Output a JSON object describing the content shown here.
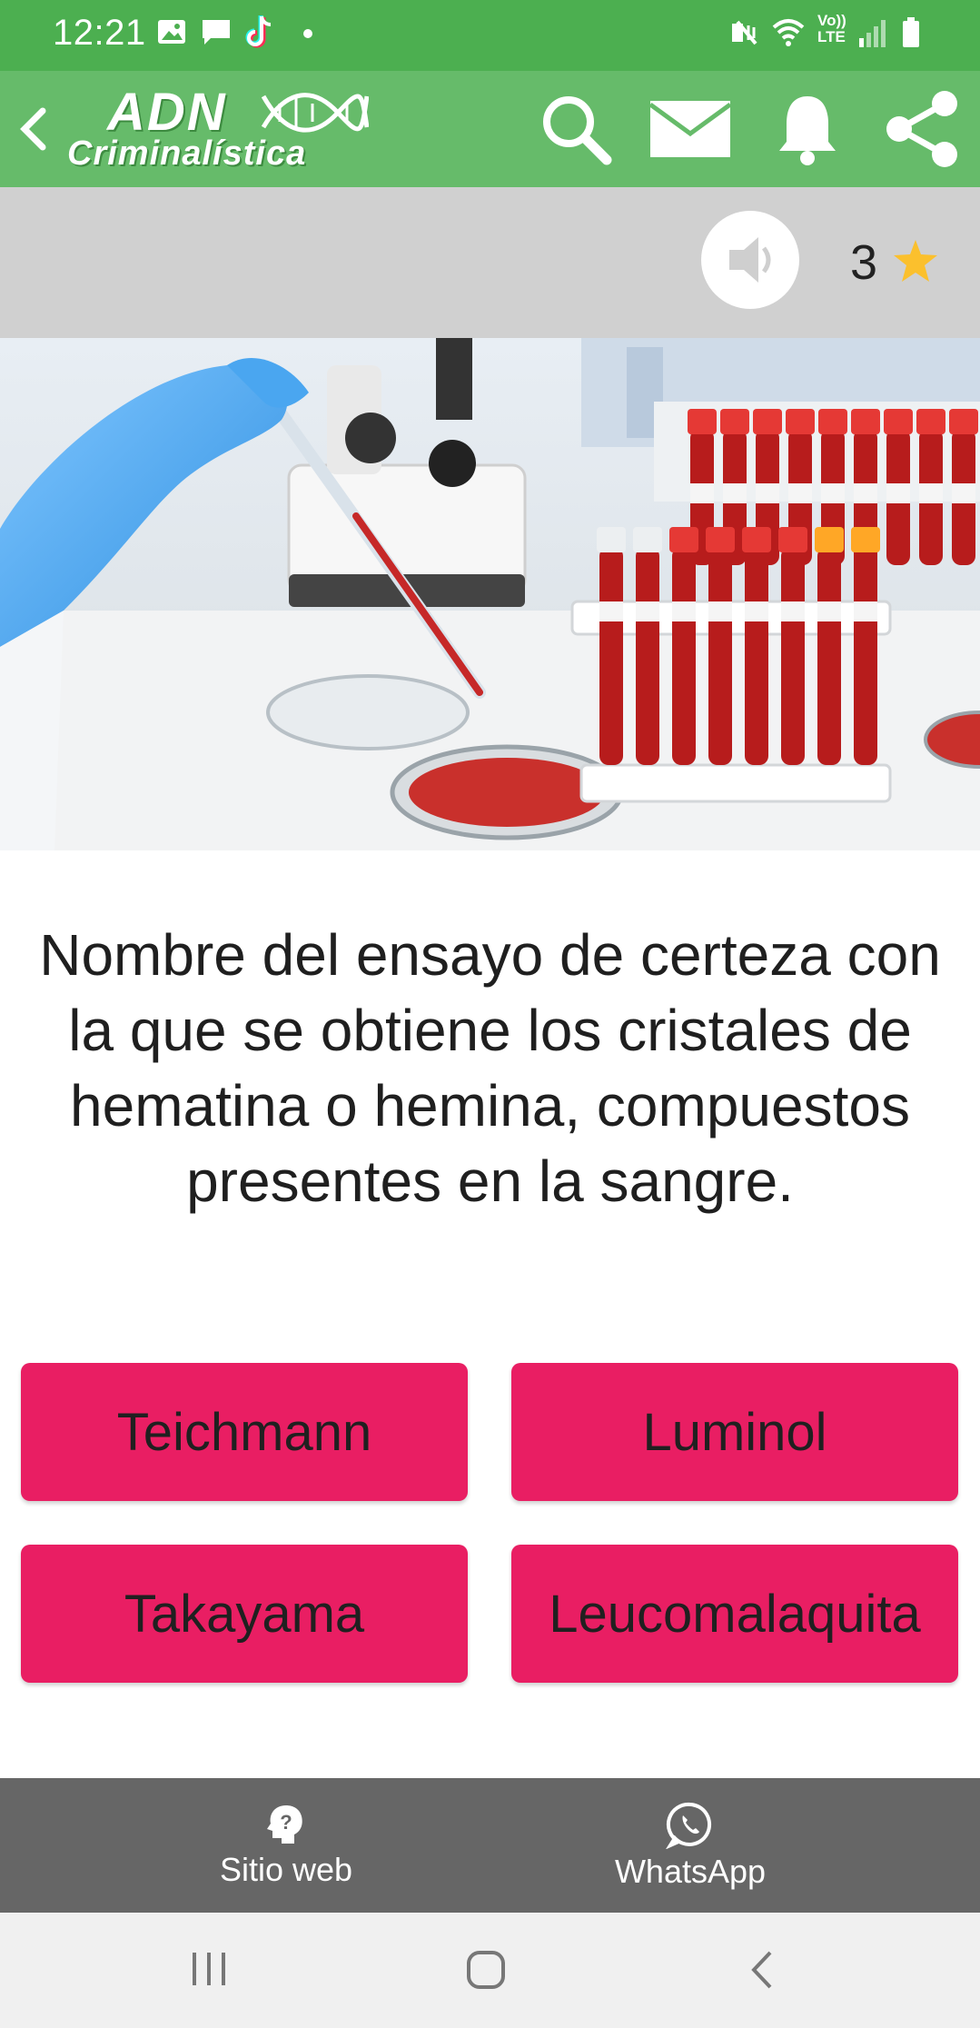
{
  "status_bar": {
    "time": "12:21",
    "icons": [
      "gallery-icon",
      "message-icon",
      "tiktok-icon",
      "dot-icon",
      "mute-icon",
      "wifi-icon",
      "volte-icon",
      "signal-icon",
      "battery-icon"
    ],
    "volte_label_top": "Vo))",
    "volte_label_bottom": "LTE"
  },
  "app_bar": {
    "logo_line1": "ADN",
    "logo_line2": "Criminalística",
    "actions": [
      "search-icon",
      "mail-icon",
      "bell-icon",
      "share-icon"
    ]
  },
  "score": {
    "value": "3"
  },
  "question": {
    "text": "Nombre del ensayo de certeza con la que se obtiene los cristales de hematina o hemina, compuestos presentes en la sangre."
  },
  "answers": [
    {
      "label": "Teichmann"
    },
    {
      "label": "Luminol"
    },
    {
      "label": "Takayama"
    },
    {
      "label": "Leucomalaquita"
    }
  ],
  "bottom_nav": {
    "items": [
      {
        "label": "Sitio web",
        "icon": "help-head-icon"
      },
      {
        "label": "WhatsApp",
        "icon": "whatsapp-icon"
      }
    ]
  },
  "colors": {
    "status_bar": "#4caf50",
    "app_bar": "#66bb6a",
    "answer_button": "#e91e63",
    "bottom_nav": "#666666",
    "star": "#fbc02d"
  }
}
